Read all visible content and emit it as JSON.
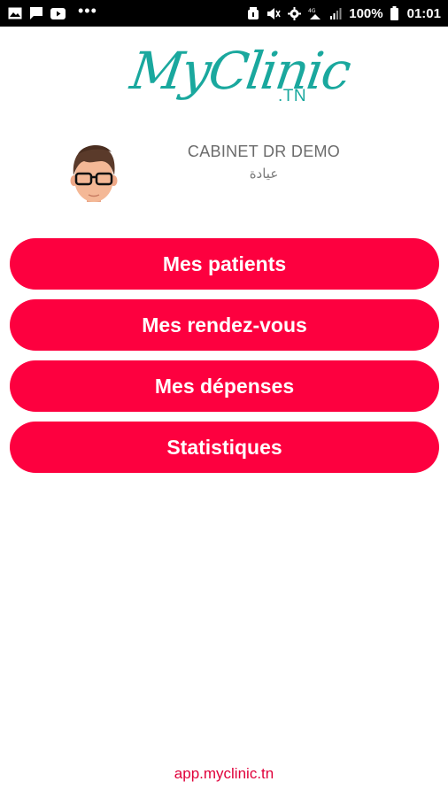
{
  "status_bar": {
    "left_icons": [
      "image-icon",
      "message-icon",
      "youtube-icon",
      "more-dots-icon"
    ],
    "battery_percent": "100%",
    "time": "01:01"
  },
  "logo": {
    "script_text": "MyClinic",
    "suffix": ".TN",
    "accent_color": "#1aa89e"
  },
  "profile": {
    "name": "CABINET DR DEMO",
    "subtitle": "عيادة"
  },
  "menu": {
    "items": [
      {
        "label": "Mes patients"
      },
      {
        "label": "Mes rendez-vous"
      },
      {
        "label": "Mes dépenses"
      },
      {
        "label": "Statistiques"
      }
    ],
    "button_color": "#fd003f"
  },
  "footer": {
    "link_text": "app.myclinic.tn"
  }
}
